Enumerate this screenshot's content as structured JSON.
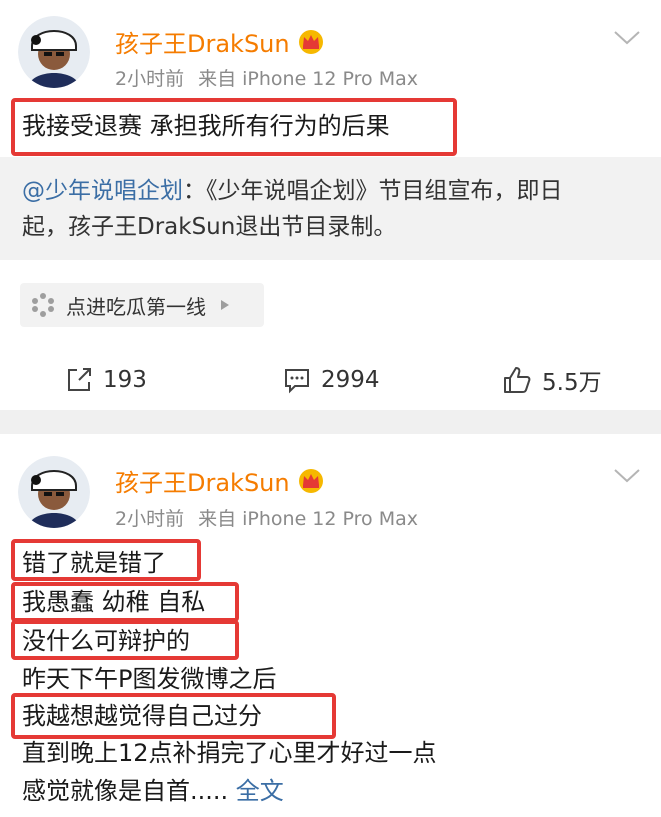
{
  "post1": {
    "username": "孩子王DrakSun",
    "time": "2小时前",
    "source": "来自 iPhone 12 Pro Max",
    "text": "我接受退赛 承担我所有行为的后果",
    "repost": {
      "mention": "@少年说唱企划",
      "line1_rest": "：《少年说唱企划》节目组宣布，即日",
      "line2": "起，孩子王DrakSun退出节目录制。"
    },
    "chip_label": "点进吃瓜第一线",
    "actions": {
      "repost_count": "193",
      "comment_count": "2994",
      "like_count": "5.5万"
    }
  },
  "post2": {
    "username": "孩子王DrakSun",
    "time": "2小时前",
    "source": "来自 iPhone 12 Pro Max",
    "lines": [
      "错了就是错了",
      "我愚蠢 幼稚 自私",
      "没什么可辩护的",
      "昨天下午P图发微博之后",
      "我越想越觉得自己过分",
      "直到晚上12点补捐完了心里才好过一点",
      "感觉就像是自首....."
    ],
    "more_label": "全文"
  },
  "colors": {
    "username": "#f57c00",
    "link": "#3b6ea5",
    "highlight_box": "#e53935"
  },
  "icons": [
    "avatar",
    "crown-icon",
    "chevron-down-icon",
    "loading-icon",
    "play-triangle-icon",
    "repost-icon",
    "comment-icon",
    "like-icon"
  ]
}
